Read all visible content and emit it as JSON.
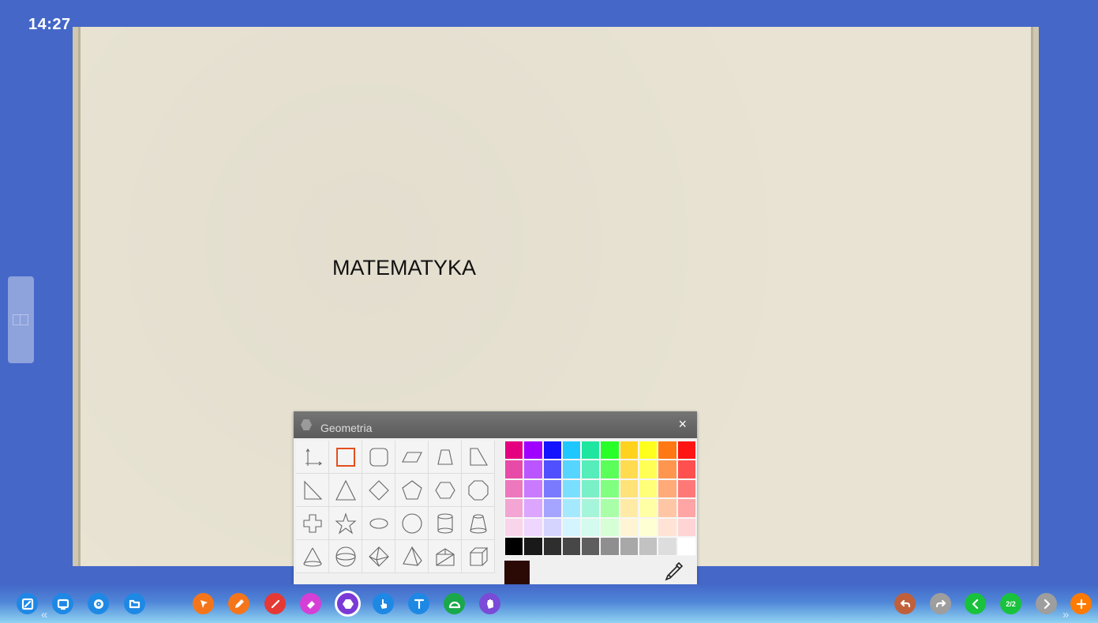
{
  "clock": "14:27",
  "board": {
    "title": "MATEMATYKA"
  },
  "geometry_panel": {
    "title": "Geometria",
    "close_label": "×",
    "shape_icons": [
      "axes-icon",
      "square-icon",
      "rounded-square-icon",
      "parallelogram-icon",
      "trapezoid-icon",
      "right-trapezoid-icon",
      "right-triangle-icon",
      "triangle-icon",
      "diamond-icon",
      "pentagon-icon",
      "hexagon-icon",
      "octagon-icon",
      "cross-icon",
      "star-icon",
      "ellipse-icon",
      "circle-icon",
      "cylinder-icon",
      "frustum-icon",
      "cone-icon",
      "sphere-icon",
      "octahedron-icon",
      "pyramid-icon",
      "prism-icon",
      "cube-icon"
    ],
    "selected_shape": "square-icon",
    "palette": [
      [
        "#e4007f",
        "#a000ff",
        "#1414ff",
        "#1ec8ff",
        "#1ee6a0",
        "#28ff28",
        "#ffd21e",
        "#ffff1e",
        "#ff7814",
        "#ff1414"
      ],
      [
        "#e84aa7",
        "#bb55ff",
        "#5050ff",
        "#55d5ff",
        "#55edb9",
        "#5aff5a",
        "#ffdb50",
        "#ffff55",
        "#ff9650",
        "#ff5050"
      ],
      [
        "#ed78bd",
        "#c97aff",
        "#7a7aff",
        "#7adfff",
        "#7af0c8",
        "#80ff80",
        "#ffe278",
        "#ffff7a",
        "#ffaa78",
        "#ff7878"
      ],
      [
        "#f3a5d3",
        "#dca5ff",
        "#a5a5ff",
        "#a5e9ff",
        "#a5f5da",
        "#a8ffa8",
        "#ffeba5",
        "#ffffa5",
        "#ffc6a5",
        "#ffa5a5"
      ],
      [
        "#f9d4ea",
        "#eed6ff",
        "#d4d4ff",
        "#d4f4ff",
        "#d4fbed",
        "#d6ffd6",
        "#fff5d4",
        "#ffffd4",
        "#ffe3d4",
        "#ffd4d4"
      ],
      [
        "#000000",
        "#191919",
        "#2e2e2e",
        "#474747",
        "#5e5e5e",
        "#8f8f8f",
        "#a8a8a8",
        "#c2c2c2",
        "#dddddd",
        "#ffffff"
      ]
    ],
    "current_color": "#2b0a06"
  },
  "toolbar": {
    "left_icons": [
      "edit-icon",
      "screen-icon",
      "settings-icon",
      "open-folder-icon"
    ],
    "tool_icons": [
      "pointer-icon",
      "pen-icon",
      "line-icon",
      "eraser-icon",
      "geometry-icon",
      "touch-icon",
      "text-icon",
      "protractor-icon",
      "hand-icon"
    ],
    "right_icons": [
      "undo-icon",
      "redo-icon",
      "previous-page-icon",
      "page-indicator",
      "next-page-icon",
      "add-page-icon"
    ],
    "page_indicator": "2/2",
    "colors": {
      "edit": "#1e88e5",
      "screen": "#1e88e5",
      "settings": "#1e88e5",
      "folder": "#1e88e5",
      "pointer": "#f5761a",
      "pen": "#f5761a",
      "line": "#e53935",
      "eraser": "#d63fd6",
      "geometry": "#7a3ad6",
      "touch": "#1e88e5",
      "text": "#1e88e5",
      "protractor": "#1aa84a",
      "hand": "#7a4bd6",
      "undo": "#c0603a",
      "redo": "#9e9e9e",
      "prev": "#19c23c",
      "page": "#19c23c",
      "next": "#9e9e9e",
      "add": "#ff7a00"
    }
  }
}
